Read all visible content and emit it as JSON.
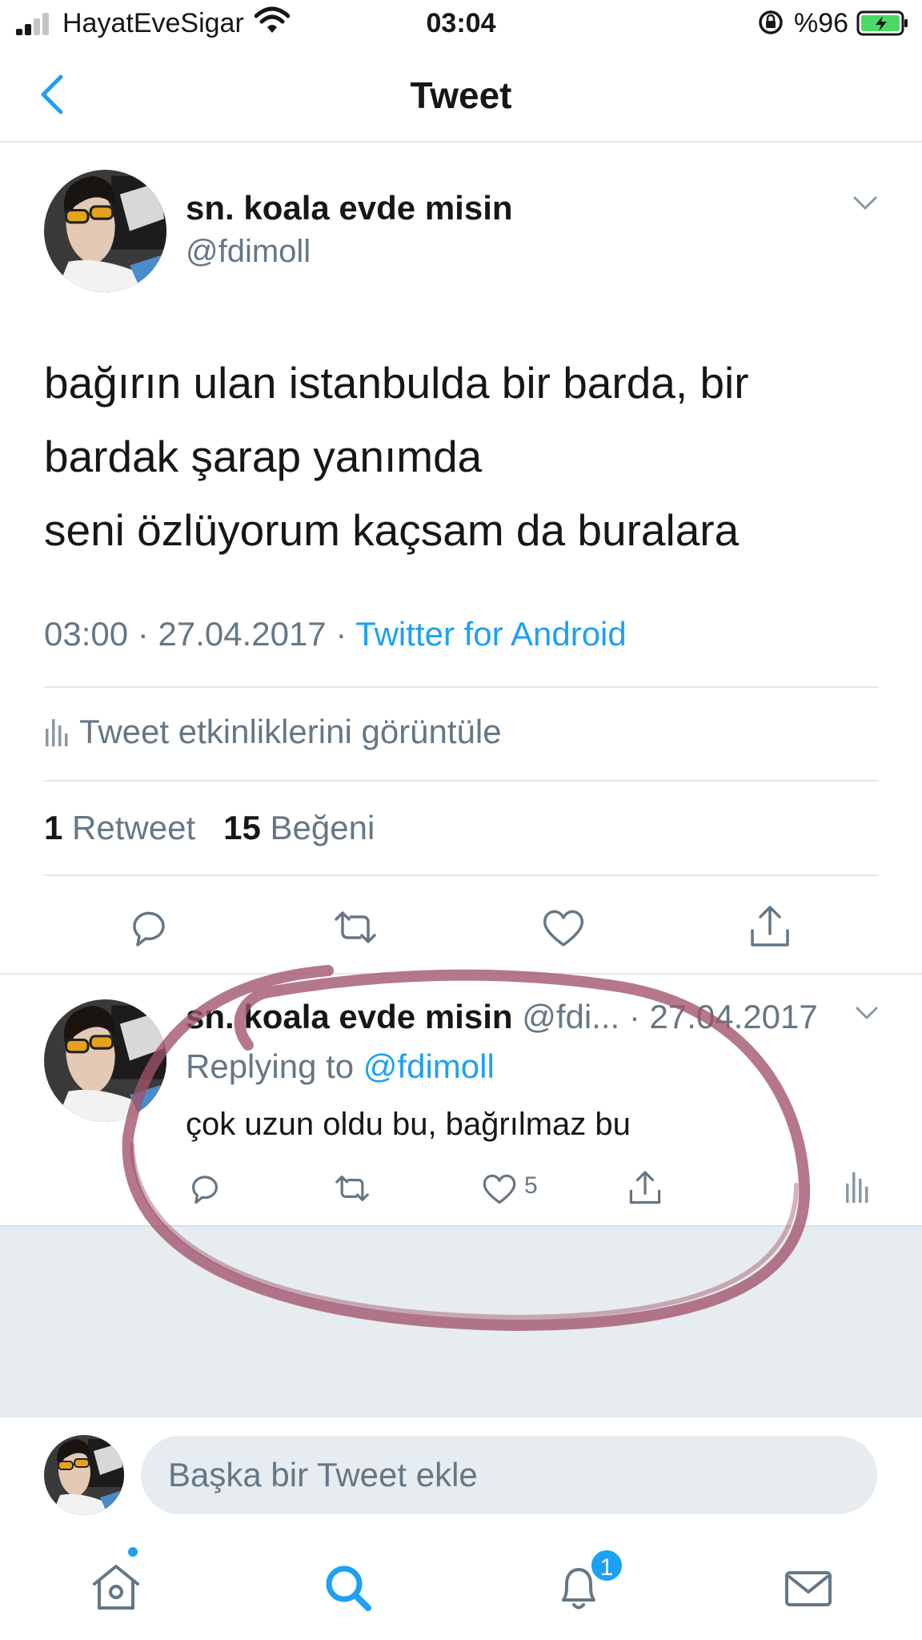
{
  "status_bar": {
    "carrier": "HayatEveSigar",
    "time": "03:04",
    "battery_percent": "%96"
  },
  "header": {
    "title": "Tweet"
  },
  "tweet": {
    "display_name": "sn. koala evde misin",
    "handle": "@fdimoll",
    "text_lines": [
      "bağırın ulan istanbulda bir barda, bir",
      "bardak şarap yanımda",
      "seni özlüyorum kaçsam da buralara"
    ],
    "time": "03:00",
    "date": "27.04.2017",
    "separator": "·",
    "source": "Twitter for Android",
    "activity_label": "Tweet etkinliklerini görüntüle",
    "retweet_count": "1",
    "retweet_label": "Retweet",
    "like_count": "15",
    "like_label": "Beğeni"
  },
  "reply": {
    "display_name": "sn. koala evde misin",
    "handle": "@fdi...",
    "date": "· 27.04.2017",
    "replying_prefix": "Replying to",
    "replying_to": "@fdimoll",
    "text": "çok uzun oldu bu, bağrılmaz bu",
    "like_count": "5"
  },
  "compose": {
    "placeholder": "Başka bir Tweet ekle"
  },
  "tab_bar": {
    "notification_badge": "1"
  },
  "colors": {
    "accent": "#1da1f2",
    "secondary_text": "#657786",
    "annotation": "#a0526a",
    "battery": "#4cd964"
  },
  "icons": [
    "back-chevron-icon",
    "chevron-down-icon",
    "stats-icon",
    "reply-icon",
    "retweet-icon",
    "like-icon",
    "share-icon",
    "home-icon",
    "search-icon",
    "bell-icon",
    "mail-icon"
  ]
}
